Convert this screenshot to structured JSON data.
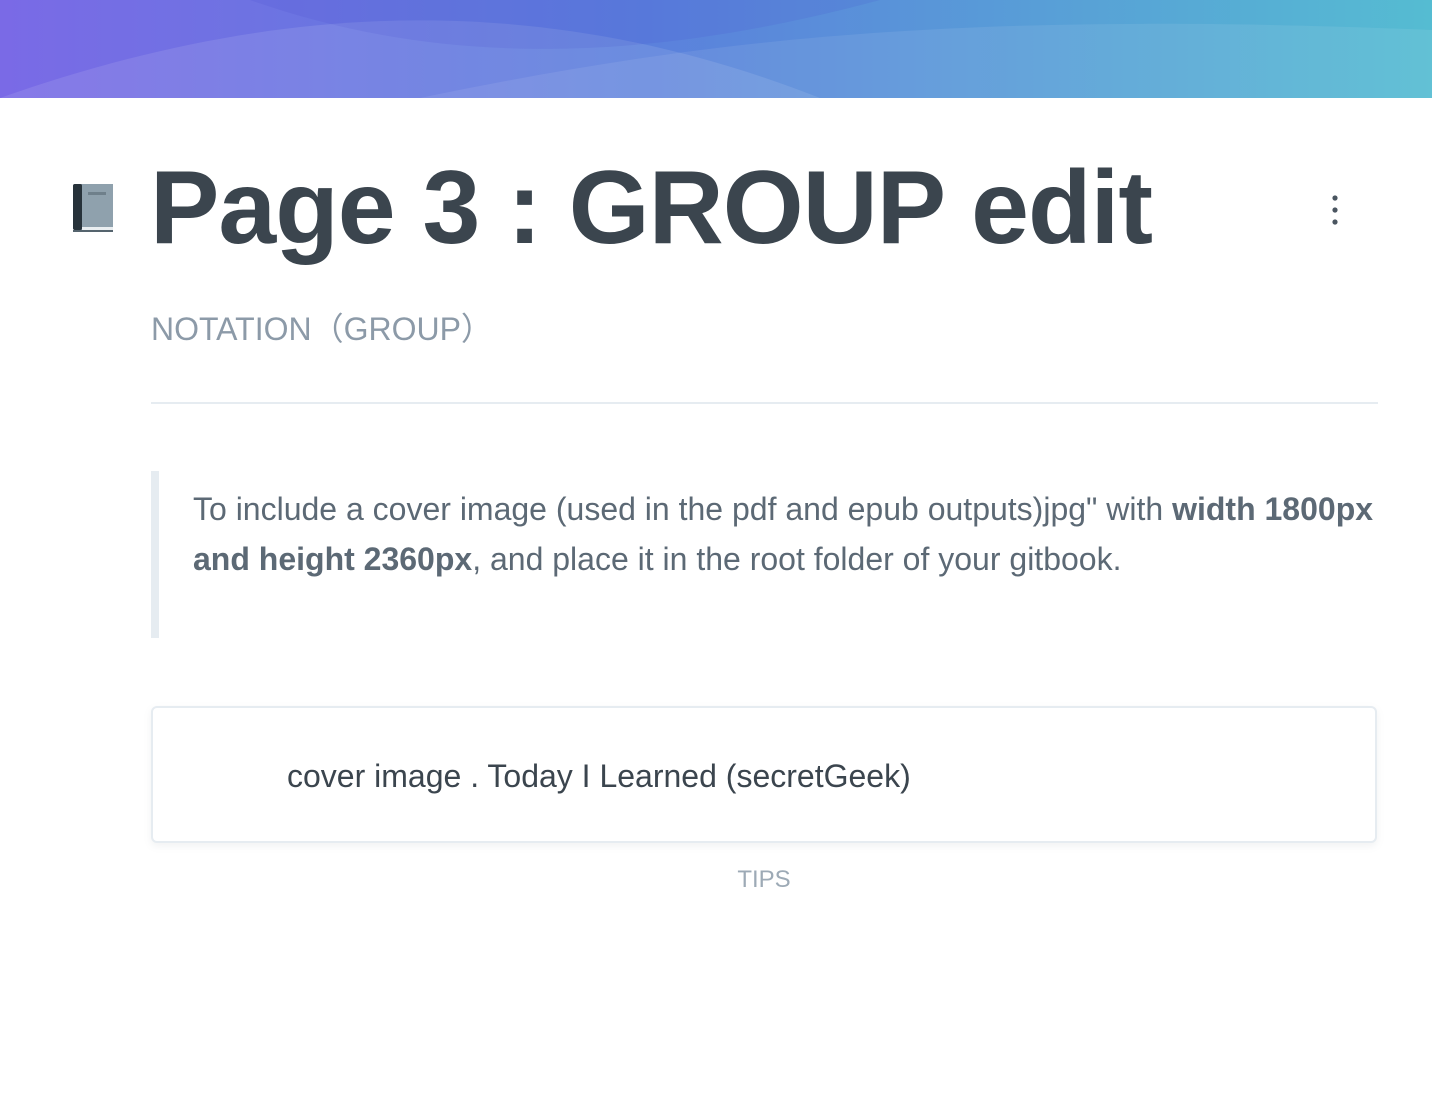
{
  "page": {
    "icon": "notebook-icon",
    "title": "Page 3 : GROUP edit",
    "subtitle": "NOTATION（GROUP）",
    "more_menu_icon": "vertical-ellipsis-icon"
  },
  "cover": {
    "gradient_colors": [
      "#7c6ee6",
      "#5b7fdc",
      "#54b8d4"
    ]
  },
  "blockquote": {
    "text_before": "To include a cover image (used in the pdf and epub outputs)jpg\" with ",
    "bold_text": "width 1800px and height 2360px",
    "text_after": ", and place it in the root folder of your gitbook."
  },
  "link_card": {
    "title": "cover image . Today I Learned (secretGeek)"
  },
  "caption": {
    "text": "TIPS"
  },
  "colors": {
    "heading": "#3b454e",
    "muted": "#8c9aa8",
    "body": "#5c6975",
    "border": "#e6ecf1"
  }
}
